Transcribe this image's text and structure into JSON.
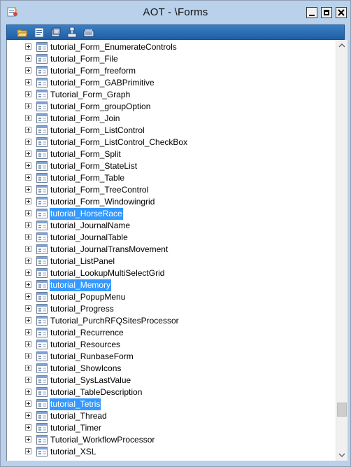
{
  "window": {
    "title": "AOT - \\Forms",
    "icon": "aot-app-icon",
    "controls": [
      "minimize-icon",
      "maximize-icon",
      "close-icon"
    ]
  },
  "toolbar": {
    "buttons": [
      "open-icon",
      "properties-icon",
      "compile-icon",
      "import-icon",
      "find-icon"
    ]
  },
  "colors": {
    "titlebar": "#b9d1ea",
    "toolbar": "#2a6db8",
    "selection": "#3399ff"
  },
  "tree": {
    "items": [
      {
        "label": "tutorial_Form_EnumerateControls",
        "selected": false
      },
      {
        "label": "tutorial_Form_File",
        "selected": false
      },
      {
        "label": "tutorial_Form_freeform",
        "selected": false
      },
      {
        "label": "tutorial_Form_GABPrimitive",
        "selected": false
      },
      {
        "label": "Tutorial_Form_Graph",
        "selected": false
      },
      {
        "label": "tutorial_Form_groupOption",
        "selected": false
      },
      {
        "label": "tutorial_Form_Join",
        "selected": false
      },
      {
        "label": "tutorial_Form_ListControl",
        "selected": false
      },
      {
        "label": "tutorial_Form_ListControl_CheckBox",
        "selected": false
      },
      {
        "label": "tutorial_Form_Split",
        "selected": false
      },
      {
        "label": "tutorial_Form_StateList",
        "selected": false
      },
      {
        "label": "tutorial_Form_Table",
        "selected": false
      },
      {
        "label": "tutorial_Form_TreeControl",
        "selected": false
      },
      {
        "label": "tutorial_Form_Windowingrid",
        "selected": false
      },
      {
        "label": "tutorial_HorseRace",
        "selected": true
      },
      {
        "label": "tutorial_JournalName",
        "selected": false
      },
      {
        "label": "tutorial_JournalTable",
        "selected": false
      },
      {
        "label": "tutorial_JournalTransMovement",
        "selected": false
      },
      {
        "label": "tutorial_ListPanel",
        "selected": false
      },
      {
        "label": "tutorial_LookupMultiSelectGrid",
        "selected": false
      },
      {
        "label": "tutorial_Memory",
        "selected": true
      },
      {
        "label": "tutorial_PopupMenu",
        "selected": false
      },
      {
        "label": "tutorial_Progress",
        "selected": false
      },
      {
        "label": "Tutorial_PurchRFQSitesProcessor",
        "selected": false
      },
      {
        "label": "tutorial_Recurrence",
        "selected": false
      },
      {
        "label": "tutorial_Resources",
        "selected": false
      },
      {
        "label": "tutorial_RunbaseForm",
        "selected": false
      },
      {
        "label": "tutorial_ShowIcons",
        "selected": false
      },
      {
        "label": "tutorial_SysLastValue",
        "selected": false
      },
      {
        "label": "tutorial_TableDescription",
        "selected": false
      },
      {
        "label": "tutorial_Tetris",
        "selected": true
      },
      {
        "label": "tutorial_Thread",
        "selected": false
      },
      {
        "label": "tutorial_Timer",
        "selected": false
      },
      {
        "label": "Tutorial_WorkflowProcessor",
        "selected": false
      },
      {
        "label": "tutorial_XSL",
        "selected": false
      }
    ]
  },
  "scrollbar": {
    "position_fraction": 0.93
  }
}
